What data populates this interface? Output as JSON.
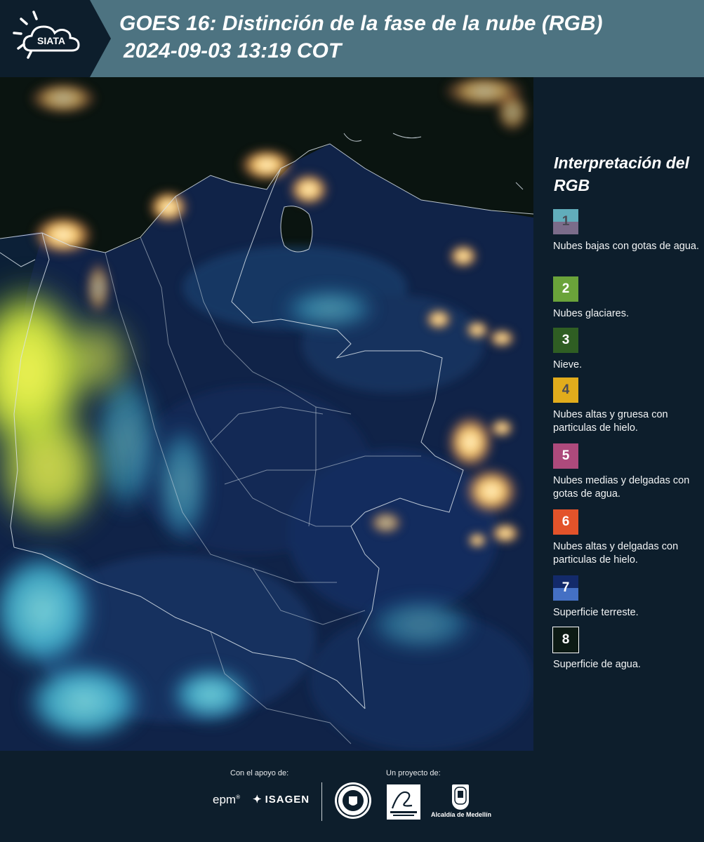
{
  "header": {
    "brand": "SIATA",
    "title_line1": "GOES 16: Distinción de la fase de la nube (RGB)",
    "title_line2": "2024-09-03 13:19 COT"
  },
  "legend": {
    "title": "Interpretación del RGB",
    "items": [
      {
        "number": "1",
        "text": "Nubes bajas con gotas de agua.",
        "color_top": "#61adbb",
        "color_bottom": "#7b6c8a",
        "number_color": "#4a4a55"
      },
      {
        "number": "2",
        "text": "Nubes glaciares.",
        "color_top": "#6aa33a",
        "color_bottom": "#6aa33a",
        "number_color": "#ffffff"
      },
      {
        "number": "3",
        "text": "Nieve.",
        "color_top": "#2f5e23",
        "color_bottom": "#2f5e23",
        "number_color": "#ffffff"
      },
      {
        "number": "4",
        "text": "Nubes altas y gruesa con particulas de hielo.",
        "color_top": "#e1ac1c",
        "color_bottom": "#e1ac1c",
        "number_color": "#4a4a55"
      },
      {
        "number": "5",
        "text": "Nubes medias y delgadas con gotas de agua.",
        "color_top": "#ad4a7c",
        "color_bottom": "#ad4a7c",
        "number_color": "#ffffff"
      },
      {
        "number": "6",
        "text": "Nubes altas y delgadas con particulas de hielo.",
        "color_top": "#e3532a",
        "color_bottom": "#e3532a",
        "number_color": "#ffffff"
      },
      {
        "number": "7",
        "text": "Superficie terreste.",
        "color_top": "#132a6a",
        "color_bottom": "#4470c4",
        "number_color": "#ffffff"
      },
      {
        "number": "8",
        "text": "Superficie de agua.",
        "color_top": "#0c1a14",
        "color_bottom": "#0c1a14",
        "number_color": "#ffffff",
        "border_color": "#ffffff"
      }
    ]
  },
  "footer": {
    "support_label": "Con el apoyo de:",
    "project_label": "Un proyecto de:",
    "sponsors": {
      "epm": "epm",
      "isagen": "ISAGEN"
    },
    "partners": {
      "medellin": "Alcaldía de Medellín"
    }
  }
}
